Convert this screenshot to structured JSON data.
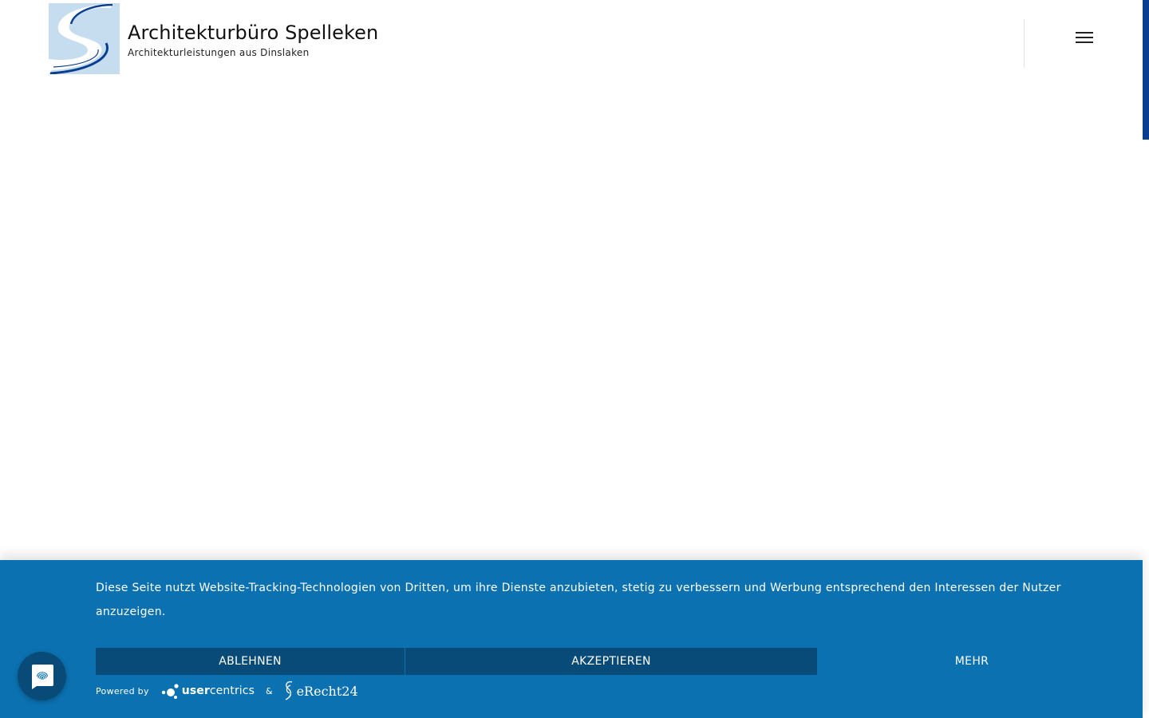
{
  "header": {
    "brand_title": "Architekturbüro Spelleken",
    "brand_tagline": "Architekturleistungen aus Dinslaken",
    "logo_icon": "s-logo",
    "menu_icon": "hamburger-menu-icon"
  },
  "cookie_banner": {
    "message": "Diese Seite nutzt Website-Tracking-Technologien von Dritten, um ihre Dienste anzubieten, stetig zu verbessern und Werbung entsprechend den Interessen der Nutzer anzuzeigen.",
    "decline_label": "ABLEHNEN",
    "accept_label": "AKZEPTIEREN",
    "more_label": "MEHR",
    "powered_by_label": "Powered by",
    "usercentrics_prefix": "user",
    "usercentrics_suffix": "centrics",
    "ampersand": "&",
    "erecht_label": "eRecht24",
    "background_color": "#0b71b0",
    "button_color": "#094b78"
  },
  "privacy_button": {
    "icon": "fingerprint-chat-icon"
  },
  "colors": {
    "accent": "#0a3f8f",
    "logo_bg": "#c6dcef"
  }
}
